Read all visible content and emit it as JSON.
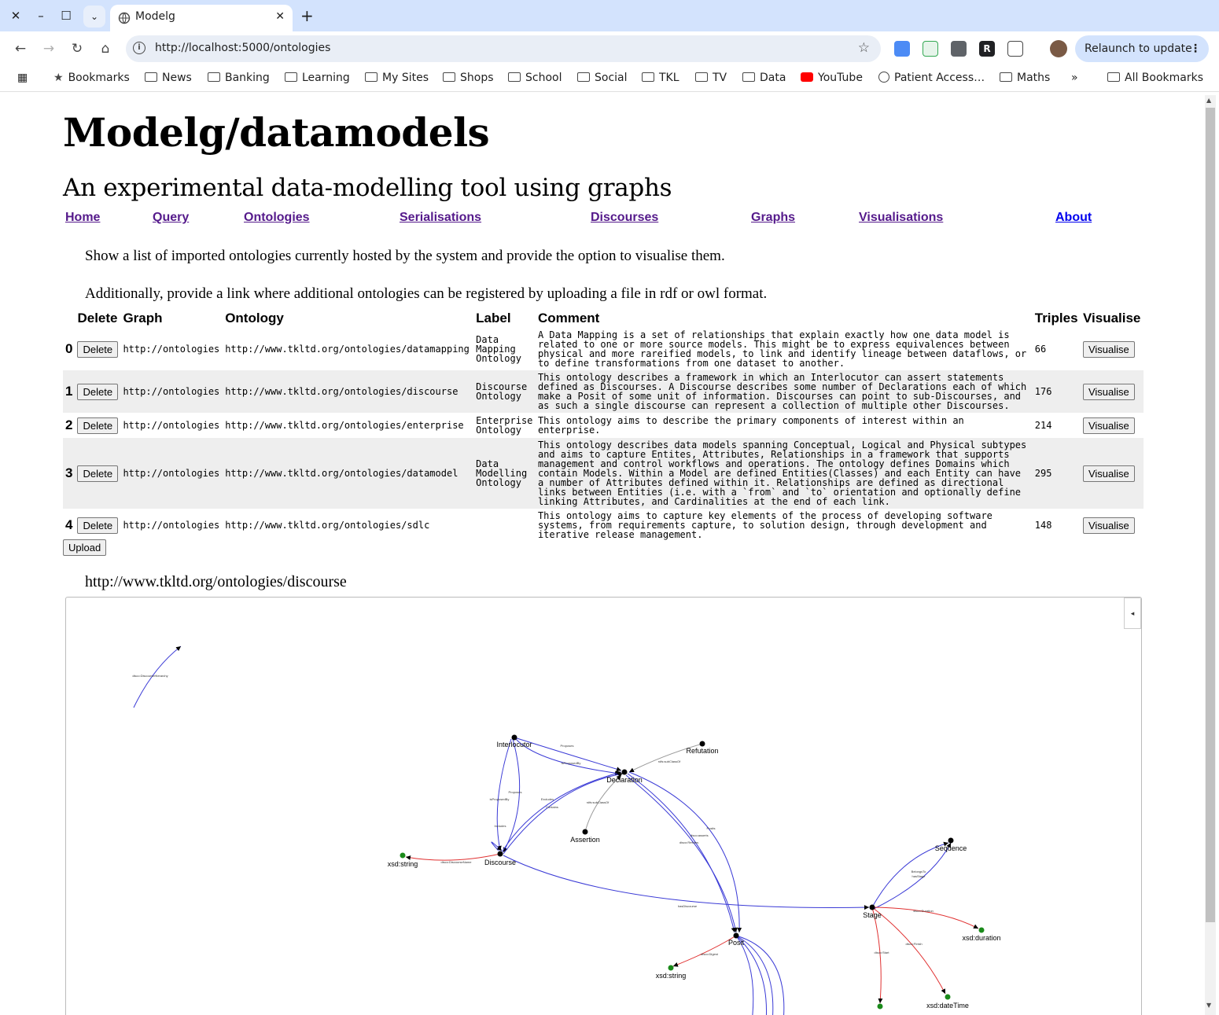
{
  "browser": {
    "tab_title": "Modelg",
    "url": "http://localhost:5000/ontologies",
    "relaunch_label": "Relaunch to update",
    "bookmarks": [
      {
        "label": "Bookmarks",
        "icon": "star-icon"
      },
      {
        "label": "News",
        "icon": "folder-icon"
      },
      {
        "label": "Banking",
        "icon": "folder-icon"
      },
      {
        "label": "Learning",
        "icon": "folder-icon"
      },
      {
        "label": "My Sites",
        "icon": "folder-icon"
      },
      {
        "label": "Shops",
        "icon": "folder-icon"
      },
      {
        "label": "School",
        "icon": "folder-icon"
      },
      {
        "label": "Social",
        "icon": "folder-icon"
      },
      {
        "label": "TKL",
        "icon": "folder-icon"
      },
      {
        "label": "TV",
        "icon": "folder-icon"
      },
      {
        "label": "Data",
        "icon": "folder-icon"
      },
      {
        "label": "YouTube",
        "icon": "youtube-icon"
      },
      {
        "label": "Patient Access…",
        "icon": "globe-icon"
      },
      {
        "label": "Maths",
        "icon": "folder-icon"
      }
    ],
    "overflow_label": "»",
    "all_bookmarks_label": "All Bookmarks"
  },
  "site": {
    "title": "Modelg/datamodels",
    "subtitle": "An experimental data-modelling tool using graphs"
  },
  "nav": [
    "Home",
    "Query",
    "Ontologies",
    "Serialisations",
    "Discourses",
    "Graphs",
    "Visualisations",
    "About"
  ],
  "intro": {
    "line1": "Show a list of imported ontologies currently hosted by the system and provide the option to visualise them.",
    "line2": "Additionally, provide a link where additional ontologies can be registered by uploading a file in rdf or owl format."
  },
  "table": {
    "headers": [
      "Delete",
      "Graph",
      "Ontology",
      "Label",
      "Comment",
      "Triples",
      "Visualise"
    ],
    "delete_label": "Delete",
    "visualise_label": "Visualise",
    "rows": [
      {
        "index": "0",
        "graph": "http://ontologies",
        "ontology": "http://www.tkltd.org/ontologies/datamapping",
        "label": "Data\nMapping\nOntology",
        "comment": "A Data Mapping is a set of relationships that explain exactly how one data model is\nrelated to one or more source models. This might be to express equivalences between\nphysical and more rareified models, to link and identify lineage between dataflows, or\nto define transformations from one dataset to another.",
        "triples": "66"
      },
      {
        "index": "1",
        "graph": "http://ontologies",
        "ontology": "http://www.tkltd.org/ontologies/discourse",
        "label": "Discourse\nOntology",
        "comment": "This ontology describes a framework in which an Interlocutor can assert statements\ndefined as Discourses. A Discourse describes some number of Declarations each of which\nmake a Posit of some unit of information. Discourses can point to sub-Discourses, and\nas such a single discourse can represent a collection of multiple other Discourses.",
        "triples": "176"
      },
      {
        "index": "2",
        "graph": "http://ontologies",
        "ontology": "http://www.tkltd.org/ontologies/enterprise",
        "label": "Enterprise\nOntology",
        "comment": "This ontology aims to describe the primary components of interest within an\nenterprise.",
        "triples": "214"
      },
      {
        "index": "3",
        "graph": "http://ontologies",
        "ontology": "http://www.tkltd.org/ontologies/datamodel",
        "label": "Data\nModelling\nOntology",
        "comment": "This ontology describes data models spanning Conceptual, Logical and Physical subtypes\nand aims to capture Entites, Attributes, Relationships in a framework that supports\nmanagement and control workflows and operations. The ontology defines Domains which\ncontain Models. Within a Model are defined Entities(Classes) and each Entity can have\na number of Attributes defined within it. Relationships are defined as directional\nlinks between Entities (i.e. with a `from` and `to` orientation and optionally define\nlinking Attributes, and Cardinalities at the end of each link.",
        "triples": "295"
      },
      {
        "index": "4",
        "graph": "http://ontologies",
        "ontology": "http://www.tkltd.org/ontologies/sdlc",
        "label": "",
        "comment": "This ontology aims to capture key elements of the process of developing software\nsystems, from requirements capture, to solution design, through development and\niterative release management.",
        "triples": "148"
      }
    ]
  },
  "upload_label": "Upload",
  "graph": {
    "title": "http://www.tkltd.org/ontologies/discourse",
    "colors": {
      "object_edge": "#3a3ad6",
      "data_edge": "#e03030",
      "class_node": "#000000",
      "literal_node": "#1a8a1a",
      "subclass_edge": "#999999"
    },
    "nodes": [
      {
        "id": "interlocutor",
        "label": "Interlocutor",
        "kind": "class"
      },
      {
        "id": "refutation",
        "label": "Refutation",
        "kind": "class"
      },
      {
        "id": "declaration",
        "label": "Declaration",
        "kind": "class"
      },
      {
        "id": "assertion",
        "label": "Assertion",
        "kind": "class"
      },
      {
        "id": "discourse",
        "label": "Discourse",
        "kind": "class"
      },
      {
        "id": "xsd_string_1",
        "label": "xsd:string",
        "kind": "literal"
      },
      {
        "id": "sequence",
        "label": "Sequence",
        "kind": "class"
      },
      {
        "id": "stage",
        "label": "Stage",
        "kind": "class"
      },
      {
        "id": "xsd_duration",
        "label": "xsd:duration",
        "kind": "literal"
      },
      {
        "id": "posit",
        "label": "Posit",
        "kind": "class"
      },
      {
        "id": "xsd_string_2",
        "label": "xsd:string",
        "kind": "literal"
      },
      {
        "id": "xsd_datetime",
        "label": "xsd:dateTime",
        "kind": "literal"
      },
      {
        "id": "literal_bottom",
        "label": "",
        "kind": "literal"
      }
    ],
    "edge_labels": [
      "disco:DiscourseHierarchy",
      "Proposes",
      "isProposedBy",
      "rdfs:subClassOf",
      "rdfs:subClassOf",
      "Proposes",
      "isProposedBy",
      "Excludes",
      "Contains",
      "Includes",
      "disco:DiscourseName",
      "Posits",
      "disco:asserts",
      "disco:Refutes",
      "hasDiscourse",
      "BelongsTo",
      "hasStage",
      "disco:Duration",
      "disco:Finish",
      "disco:Start",
      "disco:Digest"
    ]
  }
}
